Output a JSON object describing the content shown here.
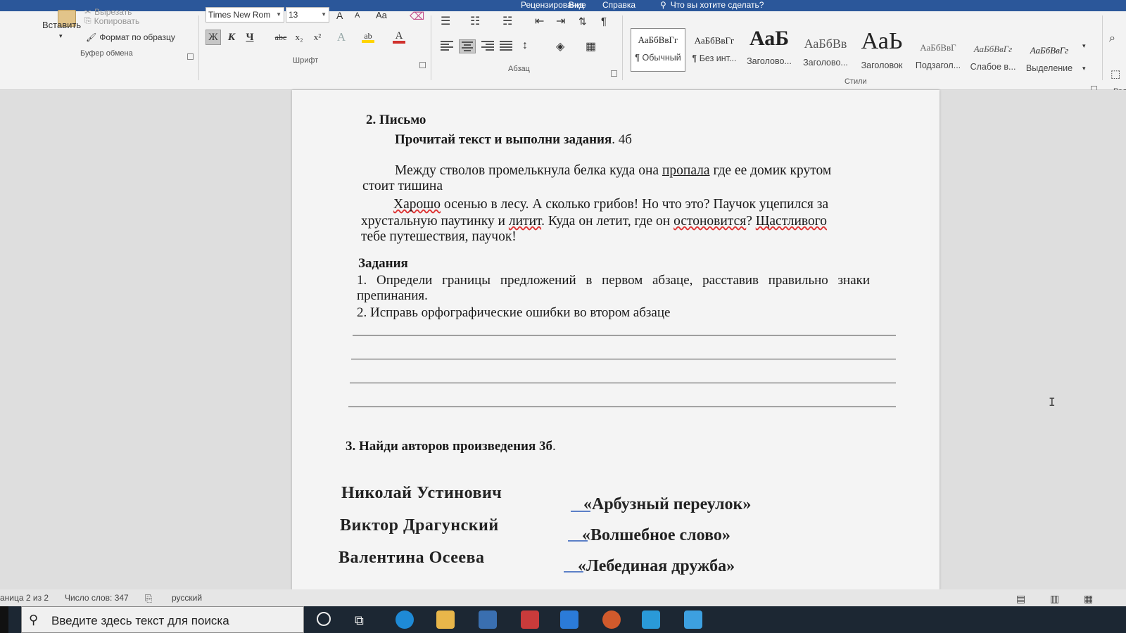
{
  "titlebar": {
    "tabs": [
      "Рецензирование",
      "Вид",
      "Справка"
    ],
    "tell_me": "Что вы хотите сделать?"
  },
  "clipboard": {
    "paste": "Вставить",
    "cut": "Вырезать",
    "copy": "Копировать",
    "format_painter": "Формат по образцу",
    "group": "Буфер обмена"
  },
  "font": {
    "name": "Times New Rom",
    "size": "13",
    "grow": "A",
    "shrink": "A",
    "case": "Aa",
    "bold": "Ж",
    "italic": "К",
    "underline": "Ч",
    "strike": "abc",
    "subscript": "x₂",
    "superscript": "x²",
    "group": "Шрифт",
    "font_color": "#d0312d",
    "highlight_color": "#ffd400"
  },
  "paragraph": {
    "group": "Абзац"
  },
  "styles": {
    "group": "Стили",
    "items": [
      {
        "sample": "АаБбВвГг",
        "name": "¶ Обычный"
      },
      {
        "sample": "АаБбВвГг",
        "name": "¶ Без инт..."
      },
      {
        "sample": "АаБ",
        "name": "Заголово..."
      },
      {
        "sample": "АаБбВв",
        "name": "Заголово..."
      },
      {
        "sample": "АаЬ",
        "name": "Заголовок"
      },
      {
        "sample": "АаБбВвГ",
        "name": "Подзагол..."
      },
      {
        "sample": "АаБбВвГг",
        "name": "Слабое в..."
      },
      {
        "sample": "АаБбВвГг",
        "name": "Выделение"
      }
    ]
  },
  "editing": {
    "label": "Ред"
  },
  "document": {
    "section2_heading": "2. Письмо",
    "instruction_bold": "Прочитай текст и выполни задания",
    "instruction_tail": ". 4б",
    "p1_l1_a": "Между стволов промелькнула белка куда она ",
    "p1_l1_u": "пропала",
    "p1_l1_b": " где ее домик крутом",
    "p1_l2": "стоит тишина",
    "p2_l1_err": "Харошо",
    "p2_l1_b": " осенью в лесу. А сколько грибов! Но что это? Паучок уцепился за",
    "p2_l2_a": "хрустальную паутинку и ",
    "p2_l2_err": "литит",
    "p2_l2_b": ". Куда он летит, где он ",
    "p2_l2_err2": "остоновится",
    "p2_l2_c": "? ",
    "p2_l2_err3": "Щастливого",
    "p2_l3": "тебе путешествия, паучок!",
    "tasks_heading": "Задания",
    "task1_l1": "1. Определи границы предложений в первом абзаце, расставив правильно знаки",
    "task1_l2": "препинания.",
    "task2": "2. Исправь орфографические ошибки во втором абзаце",
    "section3_heading": "3. Найди авторов произведения 3б",
    "section3_tail": ".",
    "authors": [
      "Николай Устинович",
      "Виктор Драгунский",
      "Валентина Осеева"
    ],
    "works": [
      "«Арбузный переулок»",
      "«Волшебное слово»",
      "«Лебединая дружба»"
    ]
  },
  "status": {
    "page": "аница 2 из 2",
    "words": "Число слов: 347",
    "language": "русский"
  },
  "taskbar": {
    "search_placeholder": "Введите здесь текст для поиска"
  }
}
